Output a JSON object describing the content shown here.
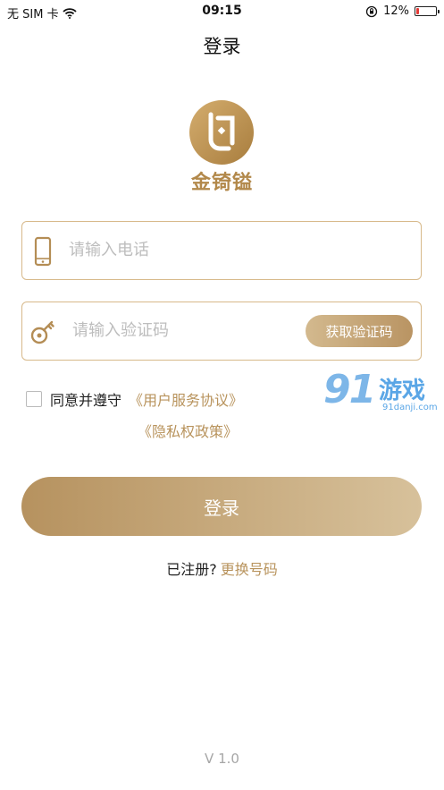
{
  "status_bar": {
    "carrier": "无 SIM 卡",
    "time": "09:15",
    "battery_percent_text": "12%",
    "battery_level": 0.12
  },
  "nav": {
    "title": "登录"
  },
  "brand": {
    "name": "金锜镒",
    "color": "#b2884a"
  },
  "form": {
    "phone_placeholder": "请输入电话",
    "code_placeholder": "请输入验证码",
    "get_code_label": "获取验证码"
  },
  "agreement": {
    "text": "同意并遵守",
    "user_agreement": "《用户服务协议》",
    "privacy_policy": "《隐私权政策》"
  },
  "login_label": "登录",
  "registered": {
    "text": "已注册?",
    "link": "更换号码"
  },
  "version": "V 1.0",
  "watermark": {
    "number": "91",
    "name": "游戏",
    "url": "91danji.com"
  },
  "colors": {
    "accent": "#b8935c",
    "border": "#d7b98a"
  },
  "icons": {
    "phone": "phone-icon",
    "key": "key-icon",
    "wifi": "wifi-icon",
    "lock": "orientation-lock-icon"
  }
}
